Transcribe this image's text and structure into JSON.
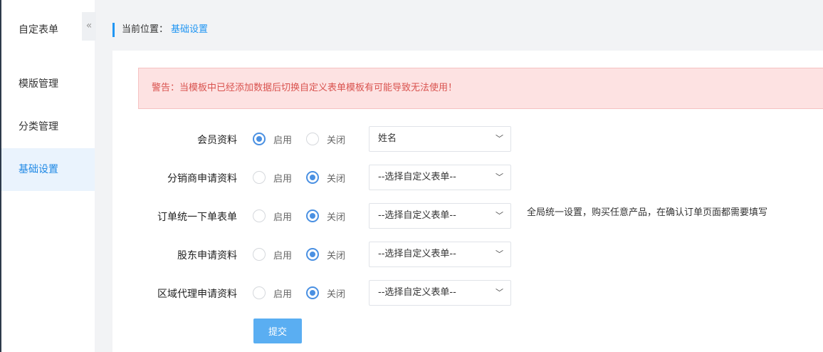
{
  "sidebar": {
    "title": "自定表单",
    "collapse_glyph": "«",
    "items": [
      {
        "label": "模版管理",
        "active": false
      },
      {
        "label": "分类管理",
        "active": false
      },
      {
        "label": "基础设置",
        "active": true
      }
    ]
  },
  "breadcrumb": {
    "prefix": "当前位置：",
    "current": "基础设置"
  },
  "warning": "警告：当模板中已经添加数据后切换自定义表单模板有可能导致无法使用！",
  "form": {
    "enable_label": "启用",
    "disable_label": "关闭",
    "rows": [
      {
        "label": "会员资料",
        "enabled": true,
        "select": "姓名"
      },
      {
        "label": "分销商申请资料",
        "enabled": false,
        "select": "--选择自定义表单--"
      },
      {
        "label": "订单统一下单表单",
        "enabled": false,
        "select": "--选择自定义表单--"
      },
      {
        "label": "股东申请资料",
        "enabled": false,
        "select": "--选择自定义表单--"
      },
      {
        "label": "区域代理申请资料",
        "enabled": false,
        "select": "--选择自定义表单--"
      }
    ],
    "hint": "全局统一设置，购买任意产品，在确认订单页面都需要填写",
    "submit_label": "提交",
    "chevron_glyph": "﹀"
  },
  "colors": {
    "accent": "#2196f3",
    "warning_bg": "#fde2e2",
    "warning_text": "#d9534f",
    "submit_bg": "#5aaef2"
  }
}
